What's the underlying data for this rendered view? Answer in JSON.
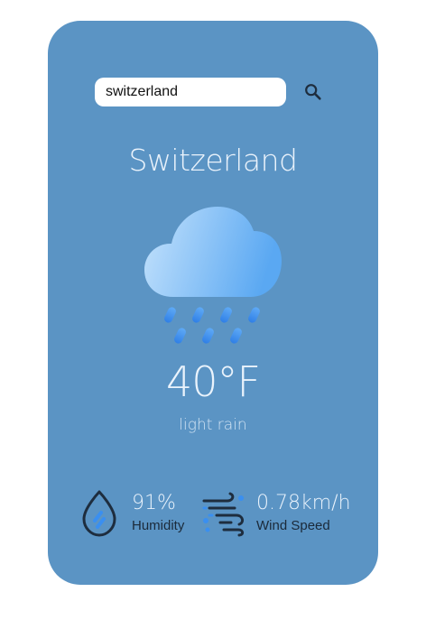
{
  "search": {
    "value": "switzerland",
    "icon": "search-icon"
  },
  "weather": {
    "city": "Switzerland",
    "temperature": "40°F",
    "description": "light rain",
    "icon": "rain-cloud-icon"
  },
  "stats": {
    "humidity_value": "91%",
    "humidity_label": "Humidity",
    "humidity_icon": "humidity-drop-icon",
    "wind_value": "0.78km/h",
    "wind_label": "Wind Speed",
    "wind_icon": "wind-icon"
  },
  "colors": {
    "card_background": "#5b94c4",
    "cloud_light": "#b7dbfb",
    "cloud_dark": "#5aa6ef",
    "raindrop": "#3d8ff0",
    "icon_dark": "#1e2d3e"
  }
}
